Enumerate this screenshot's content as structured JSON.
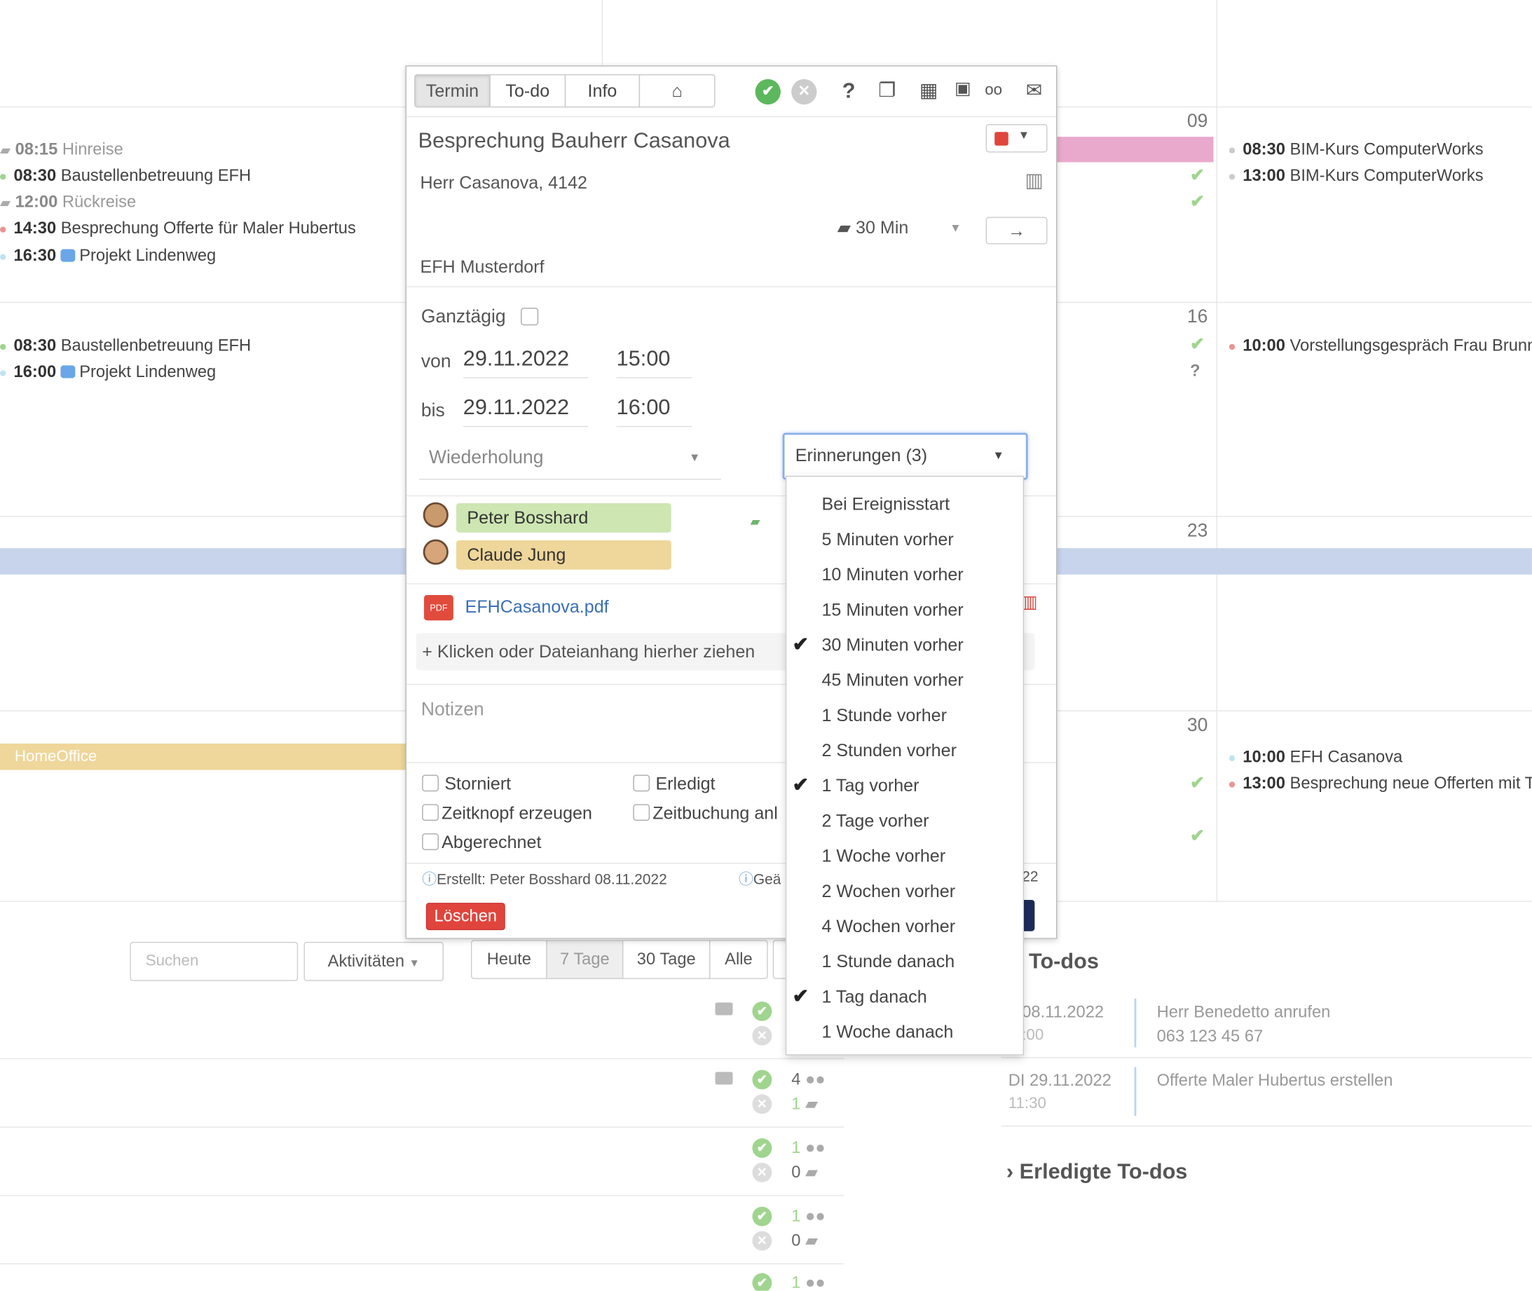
{
  "calendar": {
    "week1": {
      "events": [
        {
          "time": "08:15",
          "title": "Hinreise",
          "type": "car"
        },
        {
          "time": "08:30",
          "title": "Baustellenbetreuung EFH",
          "type": "green"
        },
        {
          "time": "12:00",
          "title": "Rückreise",
          "type": "car"
        },
        {
          "time": "14:30",
          "title": "Besprechung Offerte für Maler Hubertus",
          "type": "red"
        },
        {
          "time": "16:30",
          "title": "Projekt Lindenweg",
          "type": "cam"
        }
      ]
    },
    "week2": {
      "events": [
        {
          "time": "08:30",
          "title": "Baustellenbetreuung EFH"
        },
        {
          "time": "16:00",
          "title": "Projekt Lindenweg"
        }
      ]
    },
    "homeoffice": "HomeOffice",
    "days": [
      "09",
      "16",
      "23",
      "30"
    ],
    "right_events": [
      {
        "time": "08:30",
        "title": "BIM-Kurs ComputerWorks"
      },
      {
        "time": "13:00",
        "title": "BIM-Kurs ComputerWorks"
      },
      {
        "time": "10:00",
        "title": "Vorstellungsgespräch Frau Brunn"
      },
      {
        "time": "10:00",
        "title": "EFH Casanova"
      },
      {
        "time": "13:00",
        "title": "Besprechung neue Offerten mit T"
      }
    ],
    "question": "?"
  },
  "dialog": {
    "tabs": [
      "Termin",
      "To-do",
      "Info"
    ],
    "title": "Besprechung Bauherr Casanova",
    "contact": "Herr Casanova, 4142",
    "travel": "30 Min",
    "location": "EFH Musterdorf",
    "allday_label": "Ganztägig",
    "from_label": "von",
    "from_date": "29.11.2022",
    "from_time": "15:00",
    "to_label": "bis",
    "to_date": "29.11.2022",
    "to_time": "16:00",
    "repeat_placeholder": "Wiederholung",
    "reminders_label": "Erinnerungen (3)",
    "participants": [
      {
        "name": "Peter Bosshard",
        "color": "#cde6b2"
      },
      {
        "name": "Claude Jung",
        "color": "#efd69a"
      }
    ],
    "attachment": "EFHCasanova.pdf",
    "attach_hint": "+ Klicken oder Dateianhang hierher ziehen",
    "notes_placeholder": "Notizen",
    "checks": [
      "Storniert",
      "Erledigt",
      "Zeitknopf erzeugen",
      "Zeitbuchung anl",
      "Abgerechnet"
    ],
    "created": "Erstellt: Peter Bosshard 08.11.2022",
    "changed": "Geä",
    "changed_tail": "22",
    "delete_label": "Löschen",
    "color": "#e0453c"
  },
  "reminder_options": [
    {
      "label": "Bei Ereignisstart",
      "checked": false
    },
    {
      "label": "5 Minuten vorher",
      "checked": false
    },
    {
      "label": "10 Minuten vorher",
      "checked": false
    },
    {
      "label": "15 Minuten vorher",
      "checked": false
    },
    {
      "label": "30 Minuten vorher",
      "checked": true
    },
    {
      "label": "45 Minuten vorher",
      "checked": false
    },
    {
      "label": "1 Stunde vorher",
      "checked": false
    },
    {
      "label": "2 Stunden vorher",
      "checked": false
    },
    {
      "label": "1 Tag vorher",
      "checked": true
    },
    {
      "label": "2 Tage vorher",
      "checked": false
    },
    {
      "label": "1 Woche vorher",
      "checked": false
    },
    {
      "label": "2 Wochen vorher",
      "checked": false
    },
    {
      "label": "4 Wochen vorher",
      "checked": false
    },
    {
      "label": "1 Stunde danach",
      "checked": false
    },
    {
      "label": "1 Tag danach",
      "checked": true
    },
    {
      "label": "1 Woche danach",
      "checked": false
    }
  ],
  "bottom": {
    "search_placeholder": "Suchen",
    "activities": "Aktivitäten",
    "ranges": [
      "Heute",
      "7 Tage",
      "30 Tage",
      "Alle"
    ],
    "counts": [
      "4",
      "1",
      "1",
      "0",
      "1",
      "0",
      "1"
    ],
    "todos_title": "To-dos",
    "todos": [
      {
        "date": "08.11.2022",
        "time": ":00",
        "title": "Herr Benedetto anrufen",
        "sub": "063 123 45 67"
      },
      {
        "date": "DI 29.11.2022",
        "time": "11:30",
        "title": "Offerte Maler Hubertus erstellen",
        "sub": ""
      }
    ],
    "done_title": "Erledigte To-dos"
  }
}
